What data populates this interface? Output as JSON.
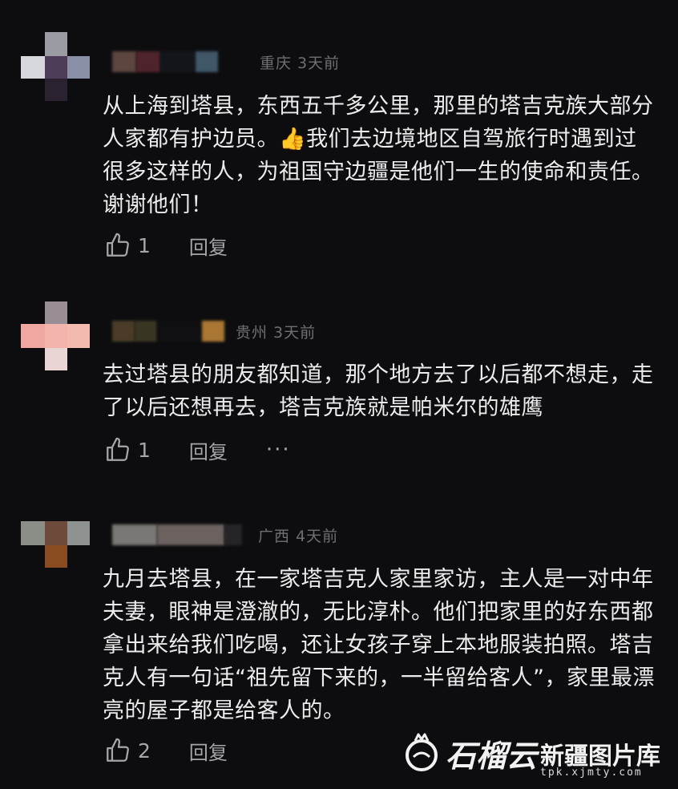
{
  "comments": [
    {
      "location": "重庆 3天前",
      "text": "从上海到塔县，东西五千多公里，那里的塔吉克族大部分人家都有护边员。👍我们去边境地区自驾旅行时遇到过很多这样的人，为祖国守边疆是他们一生的使命和责任。谢谢他们！",
      "likes": "1",
      "reply_label": "回复"
    },
    {
      "location": "贵州 3天前",
      "text": "去过塔县的朋友都知道，那个地方去了以后都不想走，走了以后还想再去，塔吉克族就是帕米尔的雄鹰",
      "likes": "1",
      "reply_label": "回复",
      "more_label": "···"
    },
    {
      "location": "广西 4天前",
      "text": "九月去塔县，在一家塔吉克人家里家访，主人是一对中年夫妻，眼神是澄澈的，无比淳朴。他们把家里的好东西都拿出来给我们吃喝，还让女孩子穿上本地服装拍照。塔吉克人有一句话“祖先留下来的，一半留给客人”，家里最漂亮的屋子都是给客人的。",
      "likes": "2",
      "reply_label": "回复"
    }
  ],
  "watermark": {
    "brand": "石榴云",
    "site": "新疆图片库",
    "url": "tpk.xjmty.com"
  },
  "colors": {
    "background": "#0d0d0f",
    "text": "#ececec",
    "muted": "#6f6f73",
    "action": "#a6a6aa"
  },
  "icons": [
    "thumbs-up-icon",
    "pomegranate-logo"
  ]
}
